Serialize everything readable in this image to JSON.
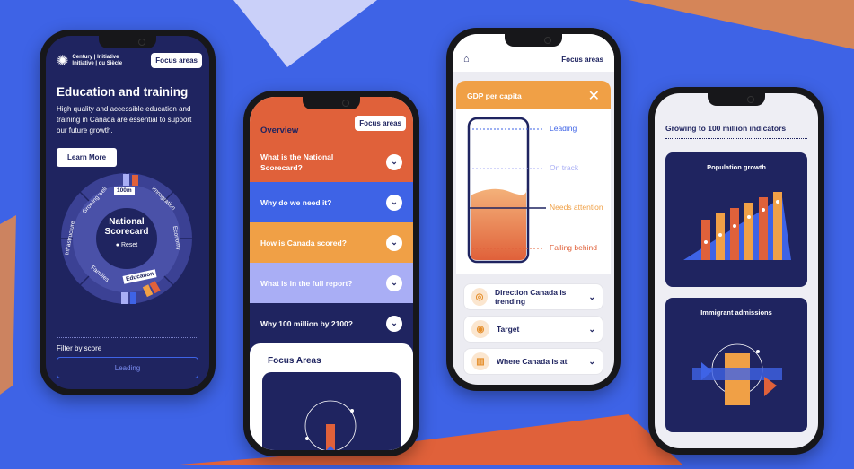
{
  "colors": {
    "background": "#3e63e6",
    "navy": "#1f2460",
    "orange": "#f0a046",
    "red": "#e0613a",
    "lavender": "#a9aef5",
    "blue": "#3e63e6"
  },
  "phone1": {
    "logo": {
      "line1a": "Century",
      "line1b": "Initiative",
      "line2a": "Initiative",
      "line2b": "du Siècle",
      "icon": "maple-leaf-icon"
    },
    "focus_areas_button": "Focus areas",
    "title": "Education and training",
    "description": "High quality and accessible education and training in Canada are essential to support our future growth.",
    "learn_more_button": "Learn More",
    "wheel": {
      "center_line1": "National",
      "center_line2": "Scorecard",
      "reset_label": "Reset",
      "segments": [
        "Growing well",
        "100m",
        "Immigration",
        "Economy",
        "Education",
        "Families",
        "Infrastructure"
      ]
    },
    "filter_label": "Filter by score",
    "filter_leading": "Leading"
  },
  "phone2": {
    "focus_areas_button": "Focus areas",
    "overview_label": "Overview",
    "accordion": [
      {
        "label": "What is the National Scorecard?",
        "color": "#e0613a"
      },
      {
        "label": "Why do we need it?",
        "color": "#3e63e6"
      },
      {
        "label": "How is Canada scored?",
        "color": "#f0a046"
      },
      {
        "label": "What is in the full report?",
        "color": "#a9aef5"
      },
      {
        "label": "Why 100 million by 2100?",
        "color": "#1f2460"
      }
    ],
    "focus_areas_heading": "Focus Areas"
  },
  "phone3": {
    "home_icon": "home-icon",
    "focus_areas_link": "Focus areas",
    "panel_title": "GDP per capita",
    "close_icon": "close-icon",
    "levels": [
      "Leading",
      "On track",
      "Needs attention",
      "Falling behind"
    ],
    "current_level": "Needs attention",
    "rows": [
      {
        "label": "Direction Canada is trending",
        "icon": "compass-icon"
      },
      {
        "label": "Target",
        "icon": "target-icon"
      },
      {
        "label": "Where Canada is at",
        "icon": "bar-chart-icon"
      }
    ]
  },
  "phone4": {
    "title": "Growing to 100 million indicators",
    "cards": [
      {
        "label": "Population growth"
      },
      {
        "label": "Immigrant admissions"
      }
    ]
  }
}
